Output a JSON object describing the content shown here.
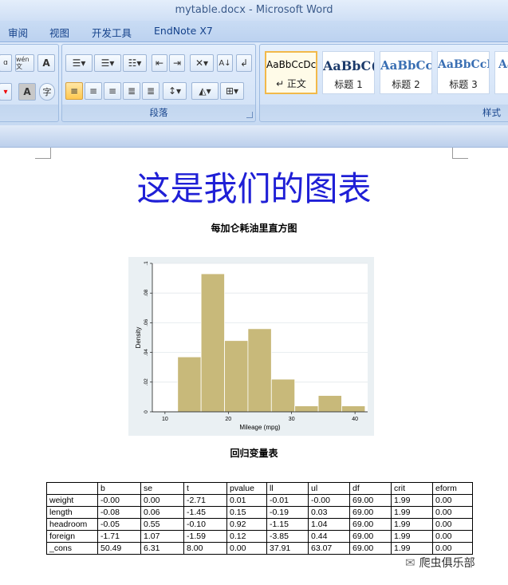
{
  "window": {
    "title": "mytable.docx - Microsoft Word"
  },
  "ribbon": {
    "tabs": [
      "审阅",
      "视图",
      "开发工具",
      "EndNote X7"
    ],
    "paragraph_group": "段落",
    "styles_group": "样式",
    "styles": [
      {
        "sample": "AaBbCcDc",
        "name": "↵ 正文"
      },
      {
        "sample": "AaBbC(",
        "name": "标题 1"
      },
      {
        "sample": "AaBbCc",
        "name": "标题 2"
      },
      {
        "sample": "AaBbCcI",
        "name": "标题 3"
      },
      {
        "sample": "Aa",
        "name": ""
      }
    ],
    "font_tools": [
      "wén 文",
      "A",
      "A",
      "字"
    ]
  },
  "document": {
    "title": "这是我们的图表",
    "figure_caption": "每加仑耗油里直方图",
    "table_caption": "回归变量表"
  },
  "chart_data": {
    "type": "bar",
    "subtype": "histogram",
    "bins": [
      {
        "from": 12,
        "to": 15.7,
        "density": 0.037
      },
      {
        "from": 15.7,
        "to": 19.4,
        "density": 0.093
      },
      {
        "from": 19.4,
        "to": 23.1,
        "density": 0.048
      },
      {
        "from": 23.1,
        "to": 26.8,
        "density": 0.056
      },
      {
        "from": 26.8,
        "to": 30.5,
        "density": 0.022
      },
      {
        "from": 30.5,
        "to": 34.2,
        "density": 0.004
      },
      {
        "from": 34.2,
        "to": 37.9,
        "density": 0.011
      },
      {
        "from": 37.9,
        "to": 41.6,
        "density": 0.004
      }
    ],
    "xlabel": "Mileage (mpg)",
    "ylabel": "Density",
    "xlim": [
      8,
      42
    ],
    "ylim": [
      0,
      0.1
    ],
    "xticks": [
      10,
      20,
      30,
      40
    ],
    "yticks": [
      0,
      0.02,
      0.04,
      0.06,
      0.08,
      0.1
    ],
    "yticklabels": [
      "0",
      ".02",
      ".04",
      ".06",
      ".08",
      ".1"
    ],
    "grid": true,
    "bar_color": "#c8b97a",
    "background": "#eaf0f3"
  },
  "regression_table": {
    "headers": [
      "",
      "b",
      "se",
      "t",
      "pvalue",
      "ll",
      "ul",
      "df",
      "crit",
      "eform"
    ],
    "rows": [
      [
        "weight",
        "-0.00",
        "0.00",
        "-2.71",
        "0.01",
        "-0.01",
        "-0.00",
        "69.00",
        "1.99",
        "0.00"
      ],
      [
        "length",
        "-0.08",
        "0.06",
        "-1.45",
        "0.15",
        "-0.19",
        "0.03",
        "69.00",
        "1.99",
        "0.00"
      ],
      [
        "headroom",
        "-0.05",
        "0.55",
        "-0.10",
        "0.92",
        "-1.15",
        "1.04",
        "69.00",
        "1.99",
        "0.00"
      ],
      [
        "foreign",
        "-1.71",
        "1.07",
        "-1.59",
        "0.12",
        "-3.85",
        "0.44",
        "69.00",
        "1.99",
        "0.00"
      ],
      [
        "_cons",
        "50.49",
        "6.31",
        "8.00",
        "0.00",
        "37.91",
        "63.07",
        "69.00",
        "1.99",
        "0.00"
      ]
    ]
  },
  "watermark": {
    "text": "爬虫俱乐部"
  }
}
